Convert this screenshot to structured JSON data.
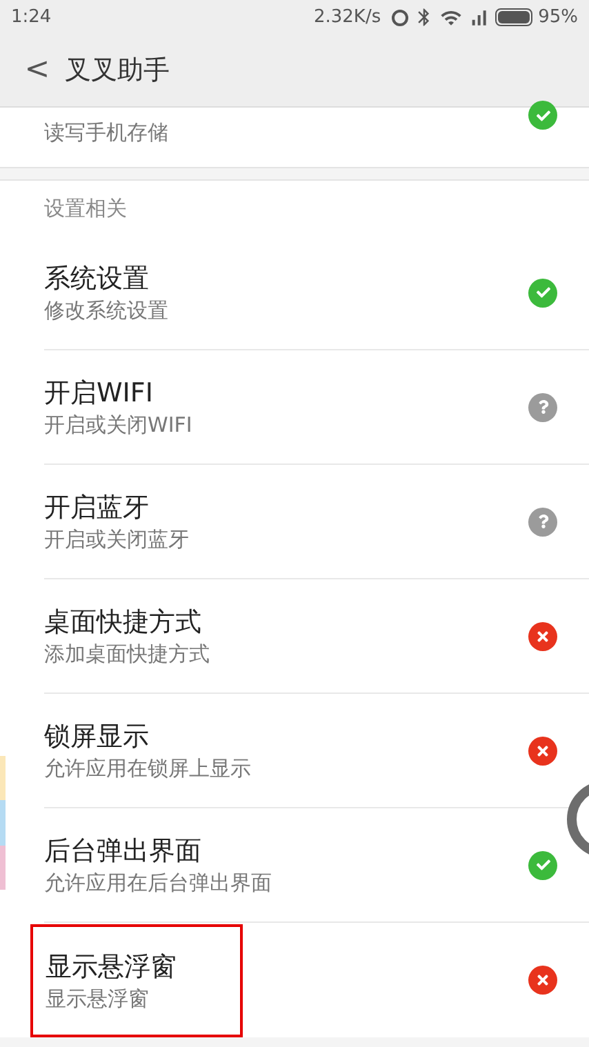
{
  "status_bar": {
    "time": "1:24",
    "speed": "2.32K/s",
    "battery": "95%"
  },
  "header": {
    "back": "<",
    "title": "叉叉助手"
  },
  "partial_row": {
    "subtitle": "读写手机存储",
    "kind": "granted"
  },
  "section": {
    "title": "设置相关",
    "rows": [
      {
        "title": "系统设置",
        "subtitle": "修改系统设置",
        "kind": "granted",
        "highlighted": false
      },
      {
        "title": "开启WIFI",
        "subtitle": "开启或关闭WIFI",
        "kind": "unknown",
        "highlighted": false
      },
      {
        "title": "开启蓝牙",
        "subtitle": "开启或关闭蓝牙",
        "kind": "unknown",
        "highlighted": false
      },
      {
        "title": "桌面快捷方式",
        "subtitle": "添加桌面快捷方式",
        "kind": "denied",
        "highlighted": false
      },
      {
        "title": "锁屏显示",
        "subtitle": "允许应用在锁屏上显示",
        "kind": "denied",
        "highlighted": false
      },
      {
        "title": "后台弹出界面",
        "subtitle": "允许应用在后台弹出界面",
        "kind": "granted",
        "highlighted": false
      },
      {
        "title": "显示悬浮窗",
        "subtitle": "显示悬浮窗",
        "kind": "denied",
        "highlighted": true
      }
    ]
  }
}
